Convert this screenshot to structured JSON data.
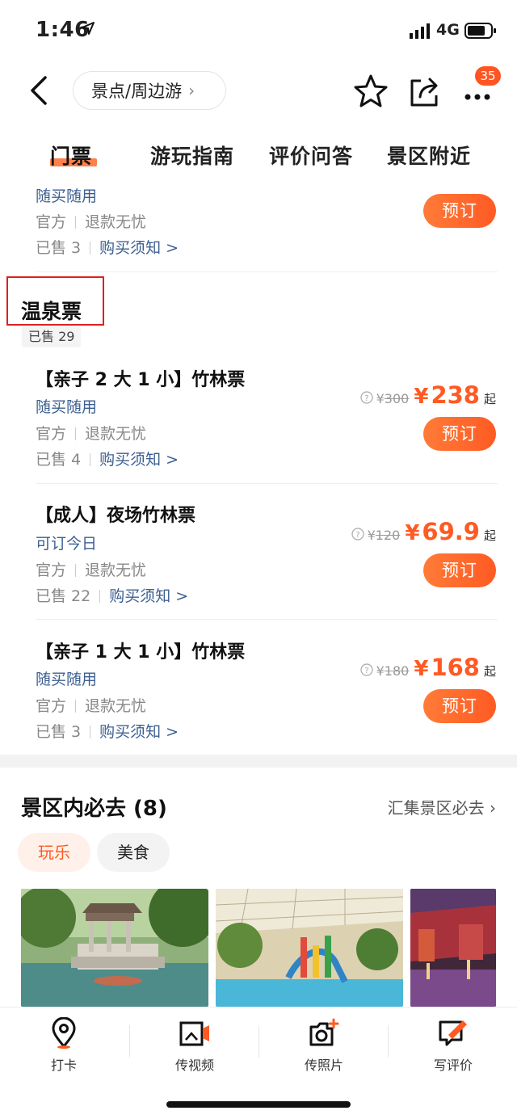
{
  "status_bar": {
    "time": "1:46",
    "network": "4G"
  },
  "nav": {
    "breadcrumb": "景点/周边游",
    "notification_count": "35"
  },
  "tabs": [
    {
      "label": "门票",
      "active": true
    },
    {
      "label": "游玩指南"
    },
    {
      "label": "评价问答"
    },
    {
      "label": "景区附近"
    }
  ],
  "top_partial_ticket": {
    "tag": "随买随用",
    "official": "官方",
    "refund": "退款无忧",
    "sold": "已售 3",
    "notice": "购买须知 >",
    "book": "预订"
  },
  "section": {
    "title": "温泉票",
    "sold": "已售 29"
  },
  "tickets": [
    {
      "title": "【亲子 2 大 1 小】竹林票",
      "tag": "随买随用",
      "official": "官方",
      "refund": "退款无忧",
      "sold": "已售 4",
      "notice": "购买须知 >",
      "orig_price": "300",
      "price": "238",
      "yen": "¥",
      "suffix": "起",
      "book": "预订"
    },
    {
      "title": "【成人】夜场竹林票",
      "tag": "可订今日",
      "official": "官方",
      "refund": "退款无忧",
      "sold": "已售 22",
      "notice": "购买须知 >",
      "orig_price": "120",
      "price": "69.9",
      "yen": "¥",
      "suffix": "起",
      "book": "预订"
    },
    {
      "title": "【亲子 1 大 1 小】竹林票",
      "tag": "随买随用",
      "official": "官方",
      "refund": "退款无忧",
      "sold": "已售 3",
      "notice": "购买须知 >",
      "orig_price": "180",
      "price": "168",
      "yen": "¥",
      "suffix": "起",
      "book": "预订"
    }
  ],
  "must_visit": {
    "title": "景区内必去 (8)",
    "link": "汇集景区必去",
    "chips": [
      "玩乐",
      "美食"
    ]
  },
  "bottom_bar": [
    {
      "label": "打卡",
      "icon": "location-pin-icon"
    },
    {
      "label": "传视频",
      "icon": "video-upload-icon"
    },
    {
      "label": "传照片",
      "icon": "camera-add-icon"
    },
    {
      "label": "写评价",
      "icon": "edit-review-icon"
    }
  ],
  "colors": {
    "accent": "#ff5a23",
    "link": "#3c5f91",
    "highlight_box": "#e01f1f"
  }
}
